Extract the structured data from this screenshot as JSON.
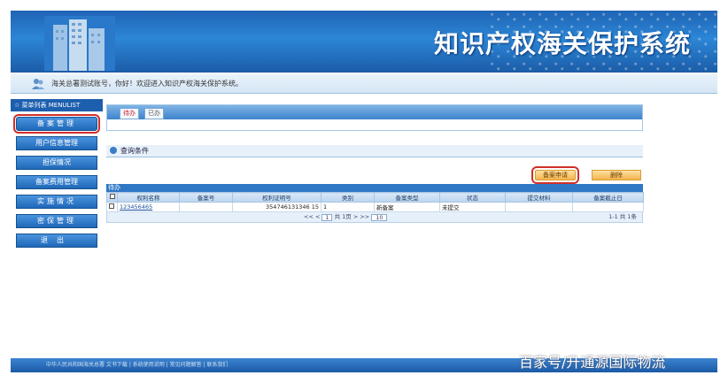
{
  "header": {
    "title": "知识产权海关保护系统"
  },
  "welcome": {
    "text": "海关总署测试账号，你好！欢迎进入知识产权海关保护系统。"
  },
  "sidebar": {
    "heading": "☆ 菜单列表 MENULIST",
    "items": [
      {
        "label": "备案管理"
      },
      {
        "label": "用户信息管理"
      },
      {
        "label": "担保情况"
      },
      {
        "label": "备案费用管理"
      },
      {
        "label": "实施情况"
      },
      {
        "label": "密保管理"
      },
      {
        "label": "退出"
      }
    ]
  },
  "tabs": [
    {
      "label": "待办"
    },
    {
      "label": "已办"
    }
  ],
  "query": {
    "label": "查询条件"
  },
  "buttons": {
    "new_application": "备案申请",
    "delete": "删除"
  },
  "grid": {
    "title": "待办",
    "columns": [
      "",
      "权利名称",
      "备案号",
      "权利证明号",
      "类别",
      "备案类型",
      "状态",
      "提交材料",
      "备案截止日"
    ],
    "rows": [
      {
        "name": "123456465",
        "record_no": "",
        "proof_no": "354746131346 15",
        "category": "1",
        "type": "新备案",
        "status": "未提交",
        "materials": "",
        "deadline": ""
      }
    ]
  },
  "pager": {
    "prev": "<< <",
    "page": "1",
    "of": "共 1页",
    "next": "> >>",
    "size": "10",
    "summary": "1-1 共 1条"
  },
  "footer": {
    "links": "中华人民共和国海关总署  文书下载  |  系统使用说明  |  常见问题解答  |  联系我们"
  },
  "watermark": {
    "text": "百家号/升通源国际物流"
  },
  "colors": {
    "banner": "#2c86d6",
    "highlight": "#d0302a"
  }
}
